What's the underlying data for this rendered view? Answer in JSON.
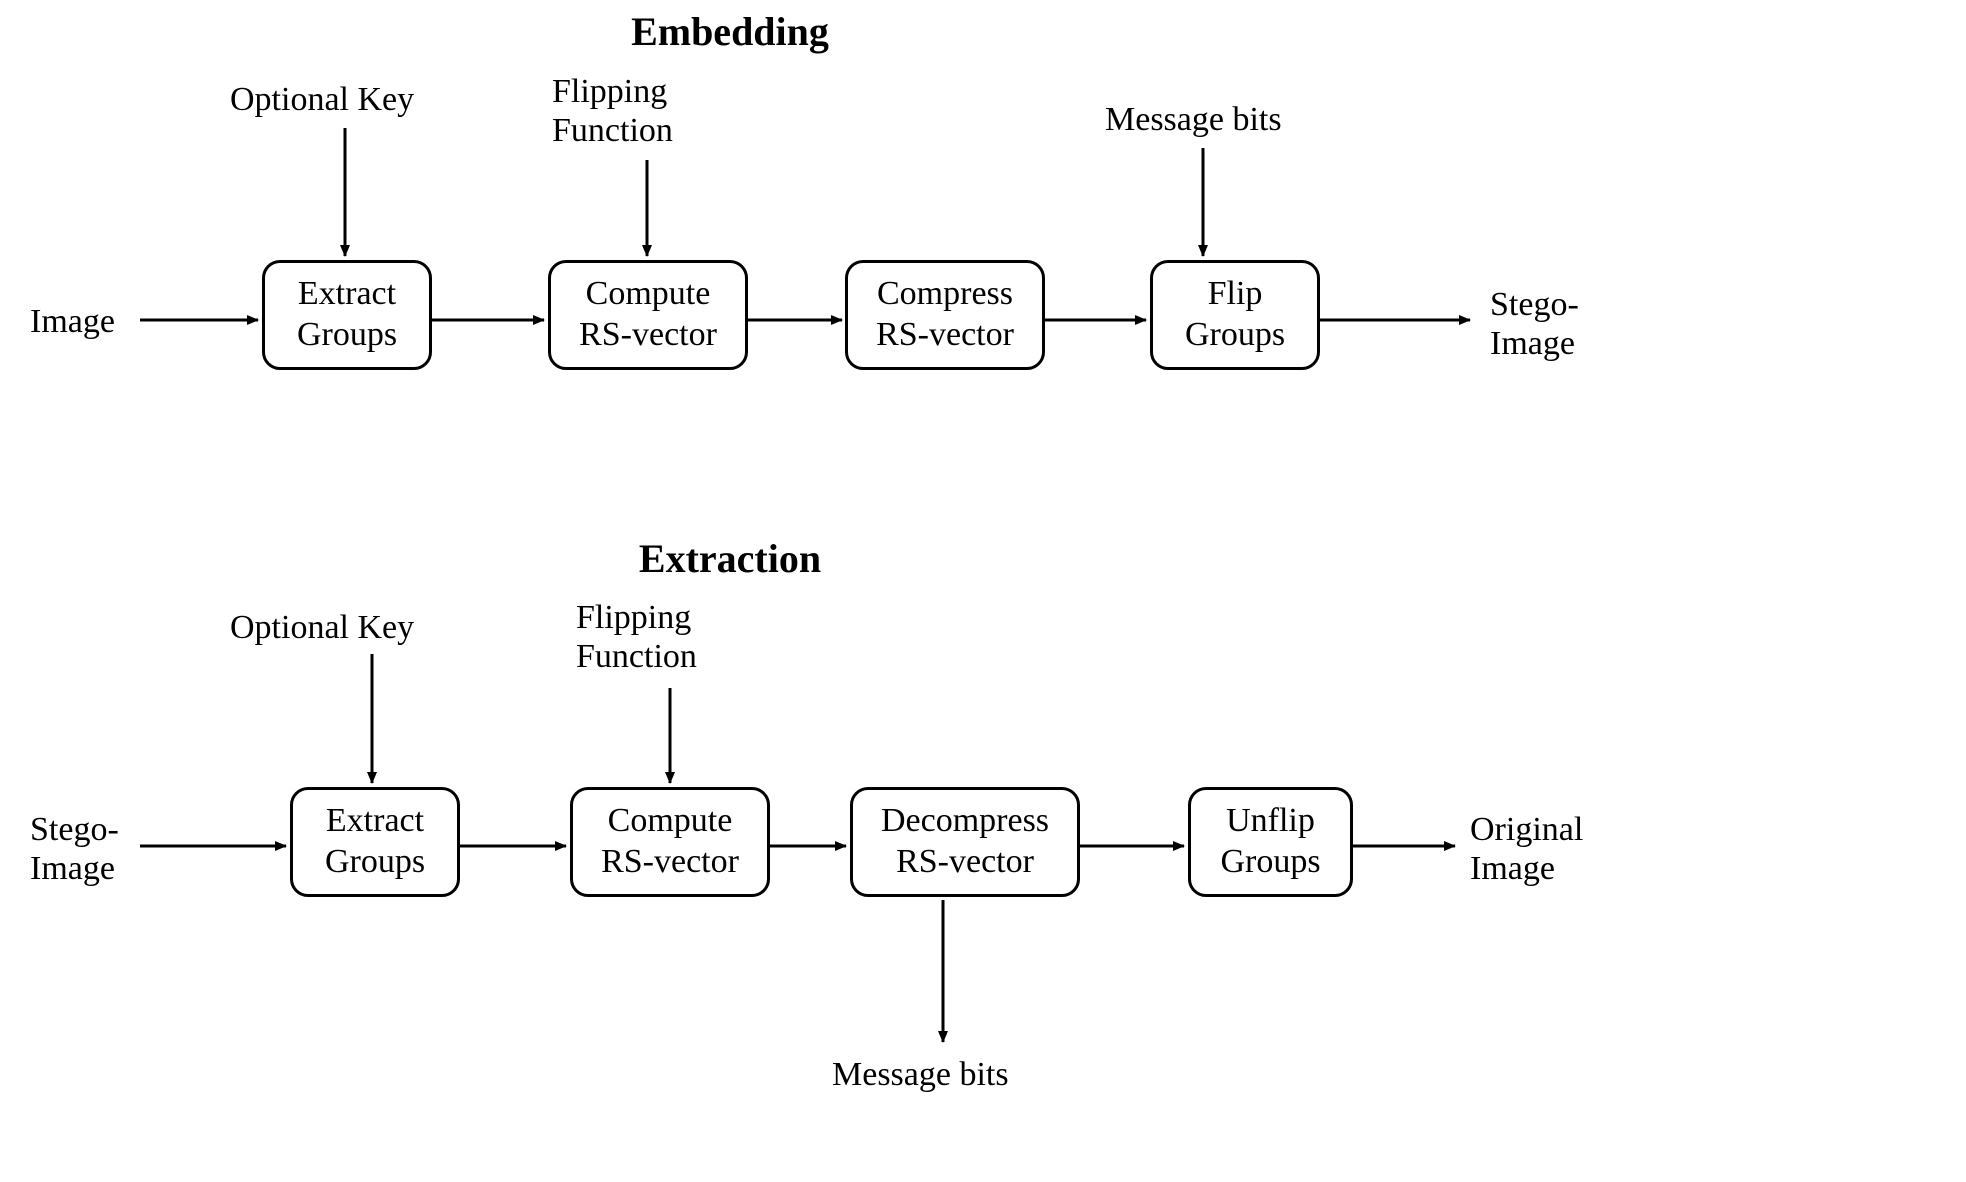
{
  "embedding": {
    "title": "Embedding",
    "input_label": "Image",
    "output_label": "Stego-\nImage",
    "top_labels": {
      "optional_key": "Optional Key",
      "flipping_function": "Flipping\nFunction",
      "message_bits": "Message bits"
    },
    "boxes": {
      "extract_groups": "Extract\nGroups",
      "compute_rs": "Compute\nRS-vector",
      "compress_rs": "Compress\nRS-vector",
      "flip_groups": "Flip\nGroups"
    }
  },
  "extraction": {
    "title": "Extraction",
    "input_label": "Stego-\nImage",
    "output_label": "Original\nImage",
    "top_labels": {
      "optional_key": "Optional Key",
      "flipping_function": "Flipping\nFunction"
    },
    "bottom_label": "Message bits",
    "boxes": {
      "extract_groups": "Extract\nGroups",
      "compute_rs": "Compute\nRS-vector",
      "decompress_rs": "Decompress\nRS-vector",
      "unflip_groups": "Unflip\nGroups"
    }
  }
}
